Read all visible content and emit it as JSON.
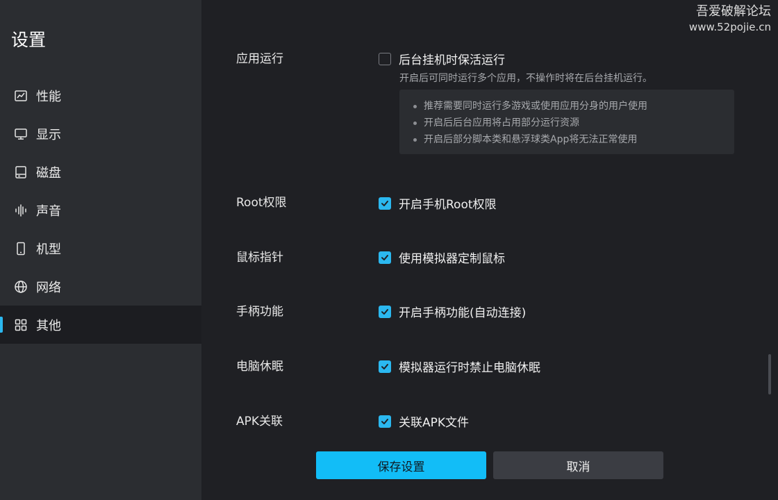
{
  "sidebar": {
    "title": "设置",
    "items": [
      {
        "label": "性能",
        "icon": "chart-icon"
      },
      {
        "label": "显示",
        "icon": "monitor-icon"
      },
      {
        "label": "磁盘",
        "icon": "disk-icon"
      },
      {
        "label": "声音",
        "icon": "sound-icon"
      },
      {
        "label": "机型",
        "icon": "phone-icon"
      },
      {
        "label": "网络",
        "icon": "globe-icon"
      },
      {
        "label": "其他",
        "icon": "grid-icon",
        "active": true
      }
    ]
  },
  "watermark": {
    "name": "吾爱破解论坛",
    "url": "www.52pojie.cn"
  },
  "settings": {
    "app_run": {
      "label": "应用运行",
      "option": "后台挂机时保活运行",
      "checked": false,
      "description": "开启后可同时运行多个应用，不操作时将在后台挂机运行。",
      "tips": [
        "推荐需要同时运行多游戏或使用应用分身的用户使用",
        "开启后后台应用将占用部分运行资源",
        "开启后部分脚本类和悬浮球类App将无法正常使用"
      ]
    },
    "root": {
      "label": "Root权限",
      "option": "开启手机Root权限",
      "checked": true
    },
    "mouse": {
      "label": "鼠标指针",
      "option": "使用模拟器定制鼠标",
      "checked": true
    },
    "gamepad": {
      "label": "手柄功能",
      "option": "开启手柄功能(自动连接)",
      "checked": true
    },
    "sleep": {
      "label": "电脑休眠",
      "option": "模拟器运行时禁止电脑休眠",
      "checked": true
    },
    "apk": {
      "label": "APK关联",
      "option": "关联APK文件",
      "checked": true
    }
  },
  "buttons": {
    "save": "保存设置",
    "cancel": "取消"
  },
  "colors": {
    "accent": "#2bb8f0",
    "save_button": "#12bdf7",
    "sidebar_bg": "#2b2d31",
    "main_bg": "#1f2024"
  }
}
